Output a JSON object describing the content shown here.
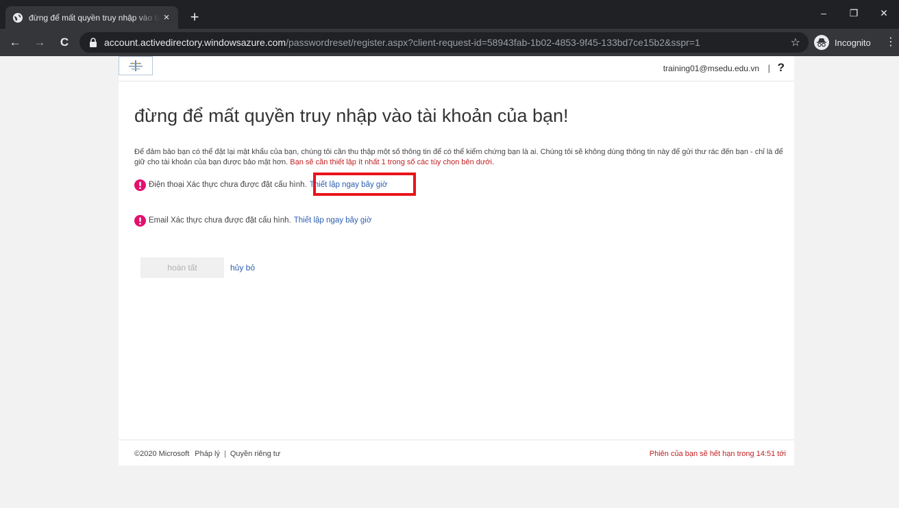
{
  "browser": {
    "tab": {
      "title": "đừng để mất quyền truy nhập vào tài khoản của bạn!",
      "close": "×"
    },
    "new_tab": "+",
    "window_controls": {
      "minimize": "–",
      "restore": "❐",
      "close": "✕"
    },
    "nav": {
      "back": "←",
      "forward": "→",
      "reload": "C"
    },
    "url": {
      "host": "account.activedirectory.windowsazure.com",
      "path": "/passwordreset/register.aspx?client-request-id=58943fab-1b02-4853-9f45-133bd7ce15b2&sspr=1"
    },
    "bookmark": "☆",
    "incognito_label": "Incognito",
    "menu": "⋮"
  },
  "header": {
    "user_email": "training01@msedu.edu.vn",
    "separator": "|",
    "help": "?"
  },
  "main": {
    "title": "đừng để mất quyền truy nhập vào tài khoản của bạn!",
    "intro": "Để đảm bảo bạn có thể đặt lại mật khẩu của bạn, chúng tôi cần thu thập một số thông tin để có thể kiểm chứng bạn là ai. Chúng tôi sẽ không dùng thông tin này để gửi thư rác đến bạn - chỉ là để giữ cho tài khoản của bạn được bảo mật hơn.",
    "intro_required": "Bạn sẽ cần thiết lập ít nhất 1 trong số các tùy chọn bên dưới.",
    "items": [
      {
        "text": "Điện thoại Xác thực chưa được đặt cấu hình.",
        "link": "Thiết lập ngay bây giờ"
      },
      {
        "text": "Email Xác thực chưa được đặt cấu hình.",
        "link": "Thiết lập ngay bây giờ"
      }
    ],
    "finish_label": "hoàn tất",
    "cancel_label": "hủy bỏ"
  },
  "footer": {
    "copyright": "©2020 Microsoft",
    "legal": "Pháp lý",
    "separator": "|",
    "privacy": "Quyền riêng tư",
    "session": "Phiên của bạn sẽ hết hạn trong 14:51 tới"
  },
  "colors": {
    "alert": "#e3106f",
    "link": "#2a5db0",
    "warning_text": "#c02020",
    "highlight": "#e8141a"
  }
}
